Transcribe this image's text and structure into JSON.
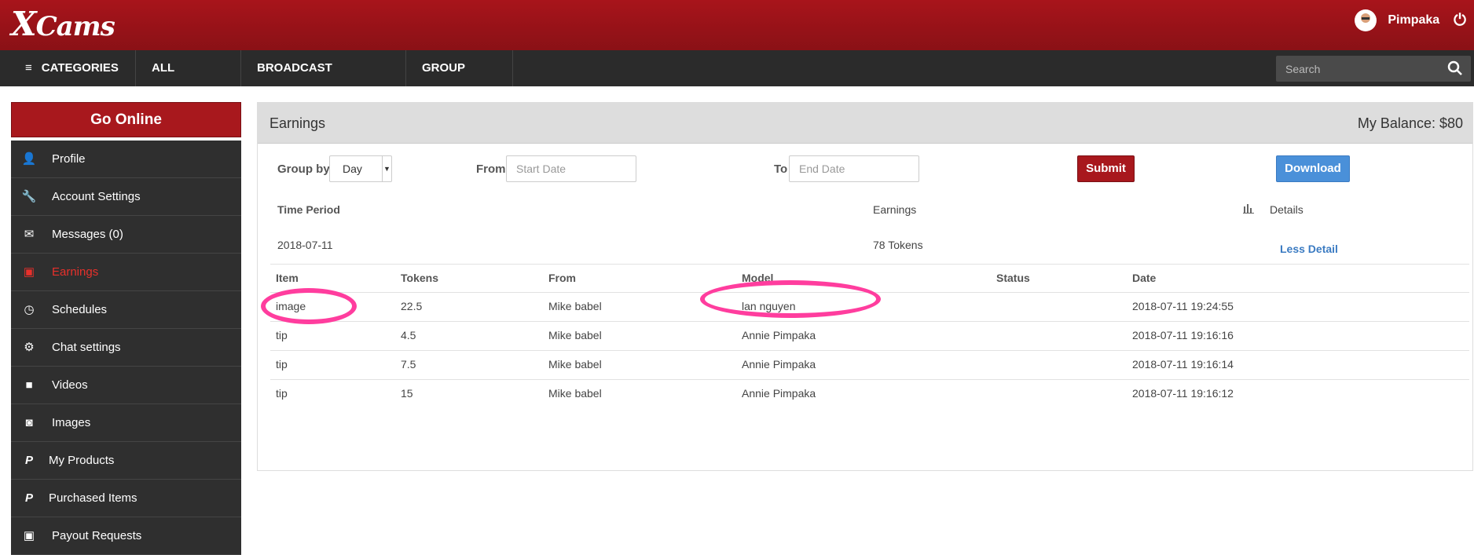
{
  "header": {
    "logo": "XCams",
    "username": "Pimpaka"
  },
  "nav": {
    "items": [
      "CATEGORIES",
      "ALL MODELS",
      "BROADCAST YOURSELF",
      "GROUP CHAT"
    ],
    "search_placeholder": "Search"
  },
  "sidebar": {
    "go_online": "Go Online",
    "items": [
      {
        "label": "Profile",
        "icon": "user-icon"
      },
      {
        "label": "Account Settings",
        "icon": "wrench-icon"
      },
      {
        "label": "Messages (0)",
        "icon": "envelope-icon"
      },
      {
        "label": "Earnings",
        "icon": "money-icon"
      },
      {
        "label": "Schedules",
        "icon": "clock-icon"
      },
      {
        "label": "Chat settings",
        "icon": "gears-icon"
      },
      {
        "label": "Videos",
        "icon": "video-camera-icon"
      },
      {
        "label": "Images",
        "icon": "camera-icon"
      },
      {
        "label": "My Products",
        "icon": "paypal-icon"
      },
      {
        "label": "Purchased Items",
        "icon": "paypal-icon"
      },
      {
        "label": "Payout Requests",
        "icon": "money-icon"
      }
    ]
  },
  "panel": {
    "title": "Earnings",
    "balance": "My Balance: $80",
    "group_by_label": "Group by",
    "group_by_value": "Day",
    "from_label": "From",
    "from_placeholder": "Start Date",
    "to_label": "To",
    "to_placeholder": "End Date",
    "submit": "Submit",
    "download": "Download",
    "summary": {
      "col_period": "Time Period",
      "col_earnings": "Earnings",
      "col_details": "Details",
      "period": "2018-07-11",
      "earnings": "78 Tokens",
      "less_detail": "Less Detail"
    },
    "table": {
      "headers": [
        "Item",
        "Tokens",
        "From",
        "Model",
        "Status",
        "Date"
      ],
      "rows": [
        [
          "image",
          "22.5",
          "Mike babel",
          "lan nguyen",
          "",
          "2018-07-11 19:24:55"
        ],
        [
          "tip",
          "4.5",
          "Mike babel",
          "Annie Pimpaka",
          "",
          "2018-07-11 19:16:16"
        ],
        [
          "tip",
          "7.5",
          "Mike babel",
          "Annie Pimpaka",
          "",
          "2018-07-11 19:16:14"
        ],
        [
          "tip",
          "15",
          "Mike babel",
          "Annie Pimpaka",
          "",
          "2018-07-11 19:16:12"
        ]
      ]
    }
  },
  "colors": {
    "brand": "#a8141b",
    "nav": "#2b2b2b",
    "active": "#e8302b",
    "download": "#4a90d9",
    "annotation": "#ff3d9e"
  }
}
